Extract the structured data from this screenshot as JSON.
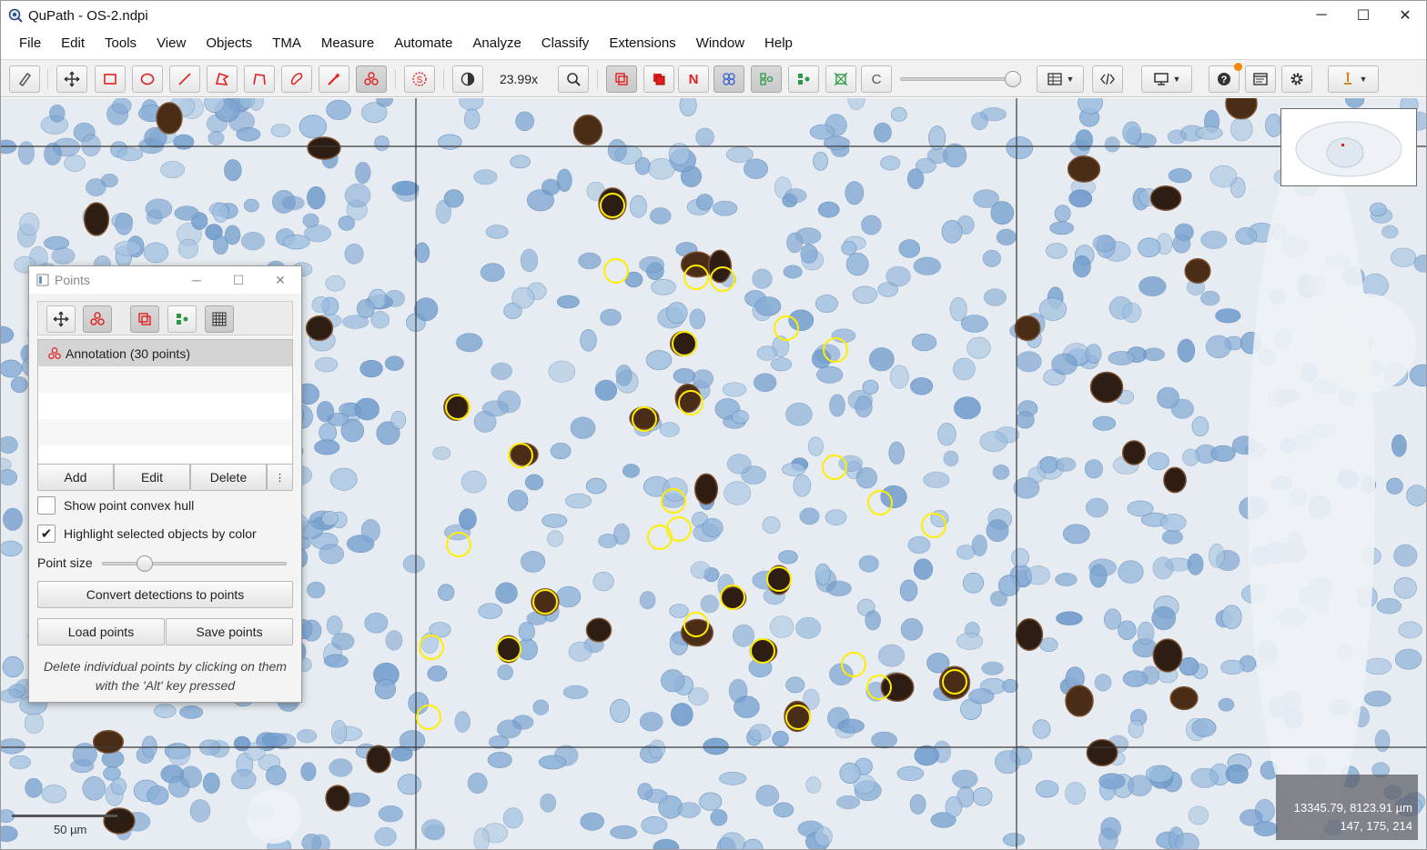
{
  "window": {
    "title": "QuPath - OS-2.ndpi",
    "controls": [
      "─",
      "☐",
      "✕"
    ]
  },
  "menu": [
    "File",
    "Edit",
    "Tools",
    "View",
    "Objects",
    "TMA",
    "Measure",
    "Automate",
    "Analyze",
    "Classify",
    "Extensions",
    "Window",
    "Help"
  ],
  "toolbar": {
    "zoom": "23.99x",
    "mode_button_letters": {
      "n": "N",
      "c": "C"
    },
    "icons": [
      "measure-tool-icon",
      "move-tool-icon",
      "rectangle-tool-icon",
      "ellipse-tool-icon",
      "line-tool-icon",
      "polygon-tool-icon",
      "polyline-tool-icon",
      "brush-tool-icon",
      "wand-tool-icon",
      "points-tool-icon",
      "selection-mode-icon",
      "brightness-contrast-icon",
      "zoom-to-fit-icon",
      "show-annotations-icon",
      "fill-annotations-icon",
      "show-names-icon",
      "show-tma-grid-icon",
      "show-detections-icon",
      "fill-detections-icon",
      "show-connections-icon",
      "show-pixel-classification-icon",
      "measurement-table-icon",
      "script-editor-icon",
      "viewer-layout-icon",
      "help-icon",
      "log-icon",
      "preferences-icon",
      "extensions-icon"
    ],
    "accent_red": "#e02020",
    "accent_blue": "#3a5fd0",
    "accent_green": "#2a9a4a"
  },
  "viewer": {
    "scalebar_label": "50 µm",
    "cursor_position": "13345.79, 8123.91 µm",
    "pixel_value": "147, 175, 214",
    "point_color": "#ffee00",
    "point_count": 30
  },
  "points_dialog": {
    "title": "Points",
    "controls": [
      "─",
      "☐",
      "✕"
    ],
    "annotation_label": "Annotation (30 points)",
    "buttons": {
      "add": "Add",
      "edit": "Edit",
      "delete": "Delete",
      "more": "⋮"
    },
    "show_convex_hull": {
      "label": "Show point convex hull",
      "checked": false
    },
    "highlight_selected": {
      "label": "Highlight selected objects by color",
      "checked": true
    },
    "point_size": {
      "label": "Point size",
      "value": 0.23
    },
    "convert_button": "Convert detections to points",
    "load_button": "Load points",
    "save_button": "Save points",
    "hint": "Delete individual points by clicking on them with the 'Alt' key pressed"
  }
}
